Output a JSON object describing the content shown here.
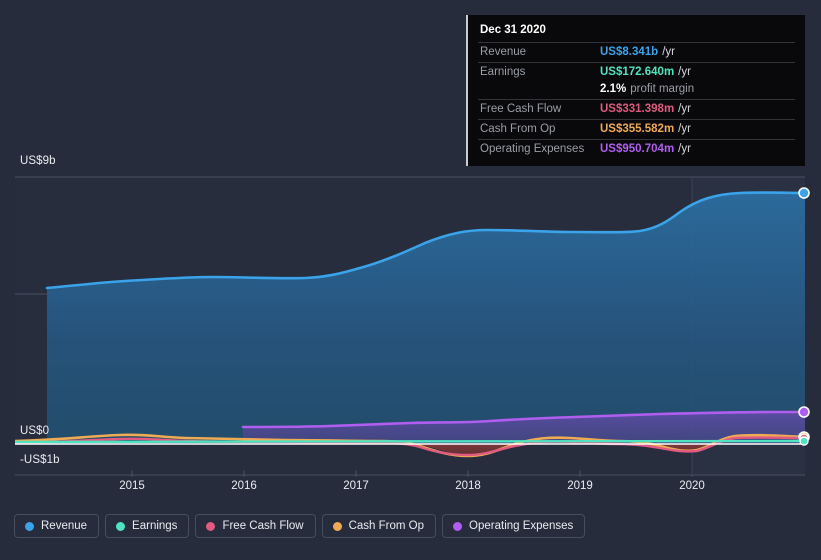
{
  "chart_data": {
    "type": "area",
    "title": "",
    "xlabel": "",
    "ylabel": "",
    "currency": "US$",
    "x_tick_labels": [
      "2015",
      "2016",
      "2017",
      "2018",
      "2019",
      "2020"
    ],
    "x_tick_values": [
      2015,
      2016,
      2017,
      2018,
      2019,
      2020
    ],
    "y_tick_labels": [
      "US$9b",
      "US$0",
      "-US$1b"
    ],
    "y_tick_values": [
      9,
      0,
      -1
    ],
    "ylim": [
      -1,
      9.6
    ],
    "xlim": [
      2014.25,
      2021.05
    ],
    "grid": true,
    "legend_position": "bottom",
    "units": "billions of USD",
    "series": [
      {
        "name": "Revenue",
        "color": "#3aa3ea",
        "x": [
          2014.25,
          2014.75,
          2015.0,
          2015.5,
          2015.75,
          2016.0,
          2016.5,
          2017.0,
          2017.25,
          2017.5,
          2018.0,
          2018.5,
          2019.0,
          2019.5,
          2019.75,
          2020.0,
          2020.5,
          2021.0
        ],
        "values": [
          5.2,
          5.28,
          5.35,
          5.52,
          5.6,
          5.5,
          5.58,
          5.95,
          6.2,
          6.45,
          6.95,
          7.0,
          6.95,
          7.05,
          7.35,
          8.05,
          8.3,
          8.341
        ],
        "end_value": 8.341,
        "end_label": "US$8.341b"
      },
      {
        "name": "Earnings",
        "color": "#4fe3c1",
        "x": [
          2014.25,
          2015.0,
          2016.0,
          2017.0,
          2018.0,
          2019.0,
          2020.0,
          2021.0
        ],
        "values": [
          0.02,
          0.03,
          0.05,
          0.08,
          0.1,
          0.12,
          0.15,
          0.17264
        ],
        "end_value": 0.17264,
        "end_label": "US$172.640m"
      },
      {
        "name": "Free Cash Flow",
        "color": "#e05a81",
        "x": [
          2014.25,
          2015.0,
          2015.75,
          2016.5,
          2017.25,
          2018.0,
          2018.5,
          2019.0,
          2019.5,
          2020.0,
          2020.5,
          2021.0
        ],
        "values": [
          0.05,
          0.1,
          0.16,
          0.08,
          0.05,
          -0.25,
          -0.05,
          0.1,
          0.05,
          -0.1,
          0.25,
          0.331398
        ],
        "end_value": 0.331398,
        "end_label": "US$331.398m"
      },
      {
        "name": "Cash From Op",
        "color": "#efab54",
        "x": [
          2014.25,
          2015.0,
          2015.75,
          2016.5,
          2017.25,
          2018.0,
          2018.5,
          2019.0,
          2019.5,
          2020.0,
          2020.5,
          2021.0
        ],
        "values": [
          0.08,
          0.14,
          0.22,
          0.14,
          0.1,
          -0.2,
          0.02,
          0.18,
          0.12,
          -0.04,
          0.32,
          0.355582
        ],
        "end_value": 0.355582,
        "end_label": "US$355.582m"
      },
      {
        "name": "Operating Expenses",
        "color": "#b05ef0",
        "x": [
          2016.0,
          2016.5,
          2017.0,
          2017.5,
          2018.0,
          2018.5,
          2019.0,
          2019.5,
          2020.0,
          2020.5,
          2021.0
        ],
        "values": [
          0.56,
          0.56,
          0.57,
          0.6,
          0.66,
          0.66,
          0.7,
          0.76,
          0.82,
          0.9,
          0.950704
        ],
        "end_value": 0.950704,
        "end_label": "US$950.704m"
      }
    ]
  },
  "axis": {
    "y_top": "US$9b",
    "y_zero": "US$0",
    "y_negative": "-US$1b",
    "x_ticks": [
      "2015",
      "2016",
      "2017",
      "2018",
      "2019",
      "2020"
    ]
  },
  "tooltip": {
    "date": "Dec 31 2020",
    "rows": [
      {
        "key": "Revenue",
        "value": "US$8.341b",
        "unit": "/yr",
        "color": "#3aa3ea"
      },
      {
        "key": "Earnings",
        "value": "US$172.640m",
        "unit": "/yr",
        "color": "#4fe3c1"
      },
      {
        "key": "",
        "value": "2.1%",
        "sub": "profit margin",
        "color": "#ffffff"
      },
      {
        "key": "Free Cash Flow",
        "value": "US$331.398m",
        "unit": "/yr",
        "color": "#e05a81"
      },
      {
        "key": "Cash From Op",
        "value": "US$355.582m",
        "unit": "/yr",
        "color": "#efab54"
      },
      {
        "key": "Operating Expenses",
        "value": "US$950.704m",
        "unit": "/yr",
        "color": "#b05ef0"
      }
    ]
  },
  "legend": {
    "items": [
      {
        "label": "Revenue",
        "color": "#3aa3ea"
      },
      {
        "label": "Earnings",
        "color": "#4fe3c1"
      },
      {
        "label": "Free Cash Flow",
        "color": "#e05a81"
      },
      {
        "label": "Cash From Op",
        "color": "#efab54"
      },
      {
        "label": "Operating Expenses",
        "color": "#b05ef0"
      }
    ]
  },
  "colors": {
    "page_background": "#262c3b",
    "plot_background": "#272d3c",
    "revenue": "#3aa3ea",
    "earnings": "#4fe3c1",
    "free_cash_flow": "#e05a81",
    "cash_from_op": "#efab54",
    "operating_expenses": "#b05ef0",
    "gridline": "#4a5062",
    "baseline": "#ffffff",
    "text": "#e9ecf1"
  }
}
